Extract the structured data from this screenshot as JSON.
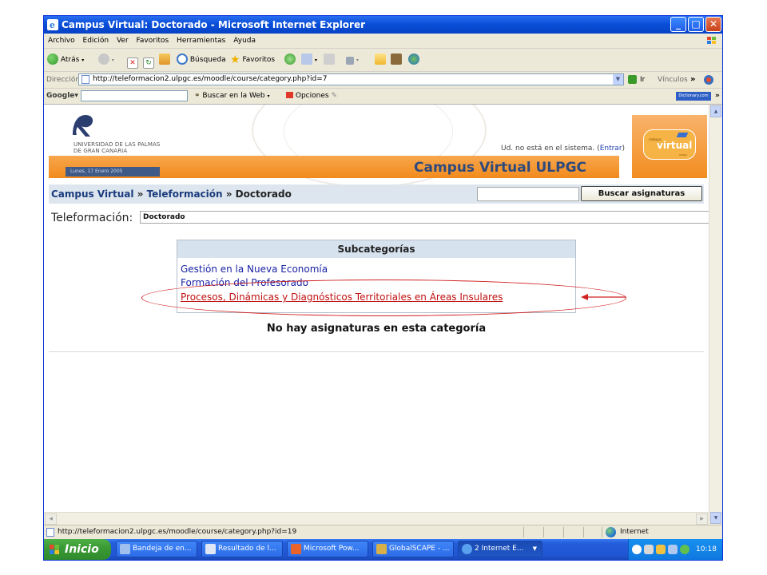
{
  "window": {
    "title": "Campus Virtual: Doctorado - Microsoft Internet Explorer",
    "minimize_glyph": "_",
    "maximize_glyph": "□",
    "close_glyph": "✕"
  },
  "menubar": {
    "items": [
      "Archivo",
      "Edición",
      "Ver",
      "Favoritos",
      "Herramientas",
      "Ayuda"
    ]
  },
  "toolbar": {
    "back_label": "Atrás",
    "search_label": "Búsqueda",
    "favorites_label": "Favoritos"
  },
  "address": {
    "label": "Dirección",
    "url": "http://teleformacion2.ulpgc.es/moodle/course/category.php?id=7",
    "go_label": "Ir",
    "links_label": "Vínculos",
    "more_glyph": "»"
  },
  "googlebar": {
    "logo": "Google▾",
    "search_web_label": "Buscar en la Web",
    "options_label": "Opciones",
    "dictionary_label": "Dictionary.com",
    "more_glyph": "»"
  },
  "page": {
    "university_name_line1": "UNIVERSIDAD DE LAS PALMAS",
    "university_name_line2": "DE GRAN CANARIA",
    "date": "Lunes, 17 Enero 2005",
    "login_status_prefix": "Ud. no está en el sistema. (",
    "login_link": "Entrar",
    "login_status_suffix": ")",
    "site_title": "Campus Virtual ULPGC",
    "logo_small": "campus",
    "logo_big": "virtual",
    "logo_tiny": "ULPGC",
    "breadcrumb": {
      "home": "Campus Virtual",
      "separator1": " » ",
      "category": "Teleformación",
      "separator2": " » ",
      "current": "Doctorado"
    },
    "search_button": "Buscar asignaturas",
    "category_label": "Teleformación:",
    "category_selected": "Doctorado",
    "subcategories_header": "Subcategorías",
    "subcategories": [
      "Gestión en la Nueva Economía",
      "Formación del Profesorado",
      "Procesos, Dinámicas y Diagnósticos Territoriales en Áreas Insulares"
    ],
    "no_courses_message": "No hay asignaturas en esta categoría"
  },
  "statusbar": {
    "url": "http://teleformacion2.ulpgc.es/moodle/course/category.php?id=19",
    "zone": "Internet"
  },
  "taskbar": {
    "start_label": "Inicio",
    "items": [
      {
        "label": "Bandeja de en...",
        "icon": "mail-icon"
      },
      {
        "label": "Resultado de l...",
        "icon": "document-icon"
      },
      {
        "label": "Microsoft Pow...",
        "icon": "powerpoint-icon"
      },
      {
        "label": "GlobalSCAPE - ...",
        "icon": "ftp-icon"
      },
      {
        "label": "2 Internet E...",
        "icon": "ie-icon"
      }
    ],
    "clock": "10:18"
  },
  "colors": {
    "title_bar": "#0a4fd8",
    "banner_orange": "#f28a1c",
    "link_blue": "#1a23a5",
    "highlight_red": "#c01010",
    "breadcrumb_bg": "#dde6ee"
  }
}
